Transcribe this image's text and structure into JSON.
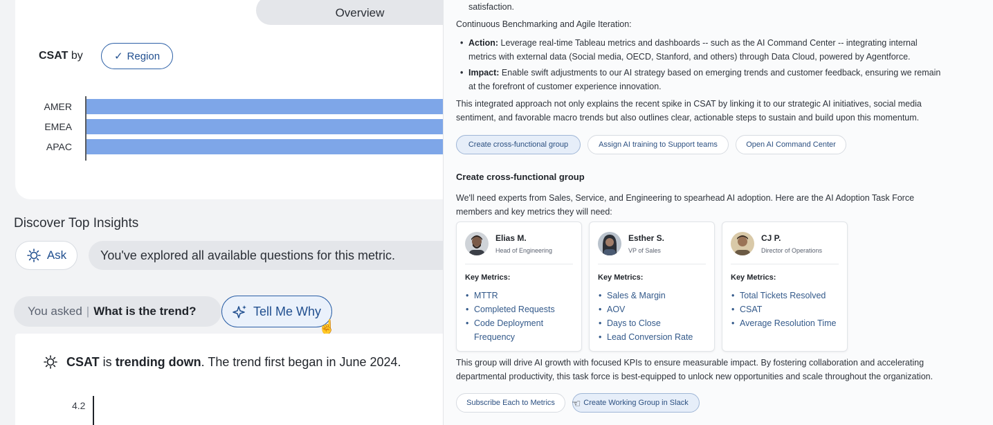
{
  "left": {
    "overview_tab": "Overview",
    "csat_card": {
      "title_bold": "CSAT",
      "title_rest": " by",
      "filter_chip": "Region",
      "filter_chip_icon": "check-icon"
    },
    "chart_data": {
      "type": "bar",
      "orientation": "horizontal",
      "categories": [
        "AMER",
        "EMEA",
        "APAC"
      ],
      "values": [
        1,
        1,
        1
      ],
      "note": "",
      "title": "",
      "xlabel": "",
      "ylabel": "",
      "bar_color": "#7ea6e8",
      "grid": false
    },
    "insights": {
      "title": "Discover Top Insights",
      "ask_label": "Ask",
      "ask_icon": "lightbulb-icon",
      "explored_message": "You've explored all available questions for this metric."
    },
    "asked": {
      "prefix": "You asked",
      "separator": "|",
      "question": "What is the trend?",
      "tell_me_why": "Tell Me Why",
      "tell_me_why_icon": "sparkle-icon"
    },
    "trend": {
      "metric": "CSAT",
      "is": " is ",
      "status": "trending down",
      "rest": ". The trend first began in June 2024.",
      "icon": "lightbulb-icon",
      "y_tick": "4.2"
    }
  },
  "right": {
    "satisfaction_tail": "satisfaction.",
    "heading_benchmark": "Continuous Benchmarking and Agile Iteration:",
    "action_label": "Action:",
    "action_line1": " Leverage real-time Tableau metrics and dashboards -- such as the AI Command Center -- integrating internal",
    "action_line2": "metrics with external data (Social media, OECD, Stanford, and others) through Data Cloud, powered by Agentforce.",
    "impact_label": "Impact:",
    "impact_line1": " Enable swift adjustments to our AI strategy based on emerging trends and customer feedback, ensuring we remain",
    "impact_line2": "at the forefront of customer experience innovation.",
    "summary_line1": "This integrated approach not only explains the recent spike in CSAT by linking it to our strategic AI initiatives, social media",
    "summary_line2": "sentiment, and favorable macro trends but also outlines clear, actionable steps to sustain and build upon this momentum.",
    "actions": [
      "Create cross-functional group",
      "Assign AI training to Support teams",
      "Open AI Command Center"
    ],
    "section_title": "Create cross-functional group",
    "intro_line1": "We'll need experts from Sales, Service, and Engineering to spearhead AI adoption. Here are the AI Adoption Task Force",
    "intro_line2": "members and key metrics they will need:",
    "key_metrics_label": "Key Metrics:",
    "people": [
      {
        "name": "Elias M.",
        "title": "Head of Engineering",
        "metrics": [
          "MTTR",
          "Completed Requests",
          "Code Deployment Frequency"
        ]
      },
      {
        "name": "Esther S.",
        "title": "VP of Sales",
        "metrics": [
          "Sales & Margin",
          "AOV",
          "Days to Close",
          "Lead Conversion Rate"
        ]
      },
      {
        "name": "CJ P.",
        "title": "Director of Operations",
        "metrics": [
          "Total Tickets Resolved",
          "CSAT",
          "Average Resolution Time"
        ]
      }
    ],
    "closing_line1": "This group will drive AI growth with focused KPIs to ensure measurable impact. By fostering collaboration and accelerating",
    "closing_line2": "departmental productivity, this task force is best-equipped to unlock new opportunities and scale throughout the organization.",
    "bottom_actions": [
      "Subscribe Each to Metrics",
      "Create Working Group in Slack"
    ]
  }
}
